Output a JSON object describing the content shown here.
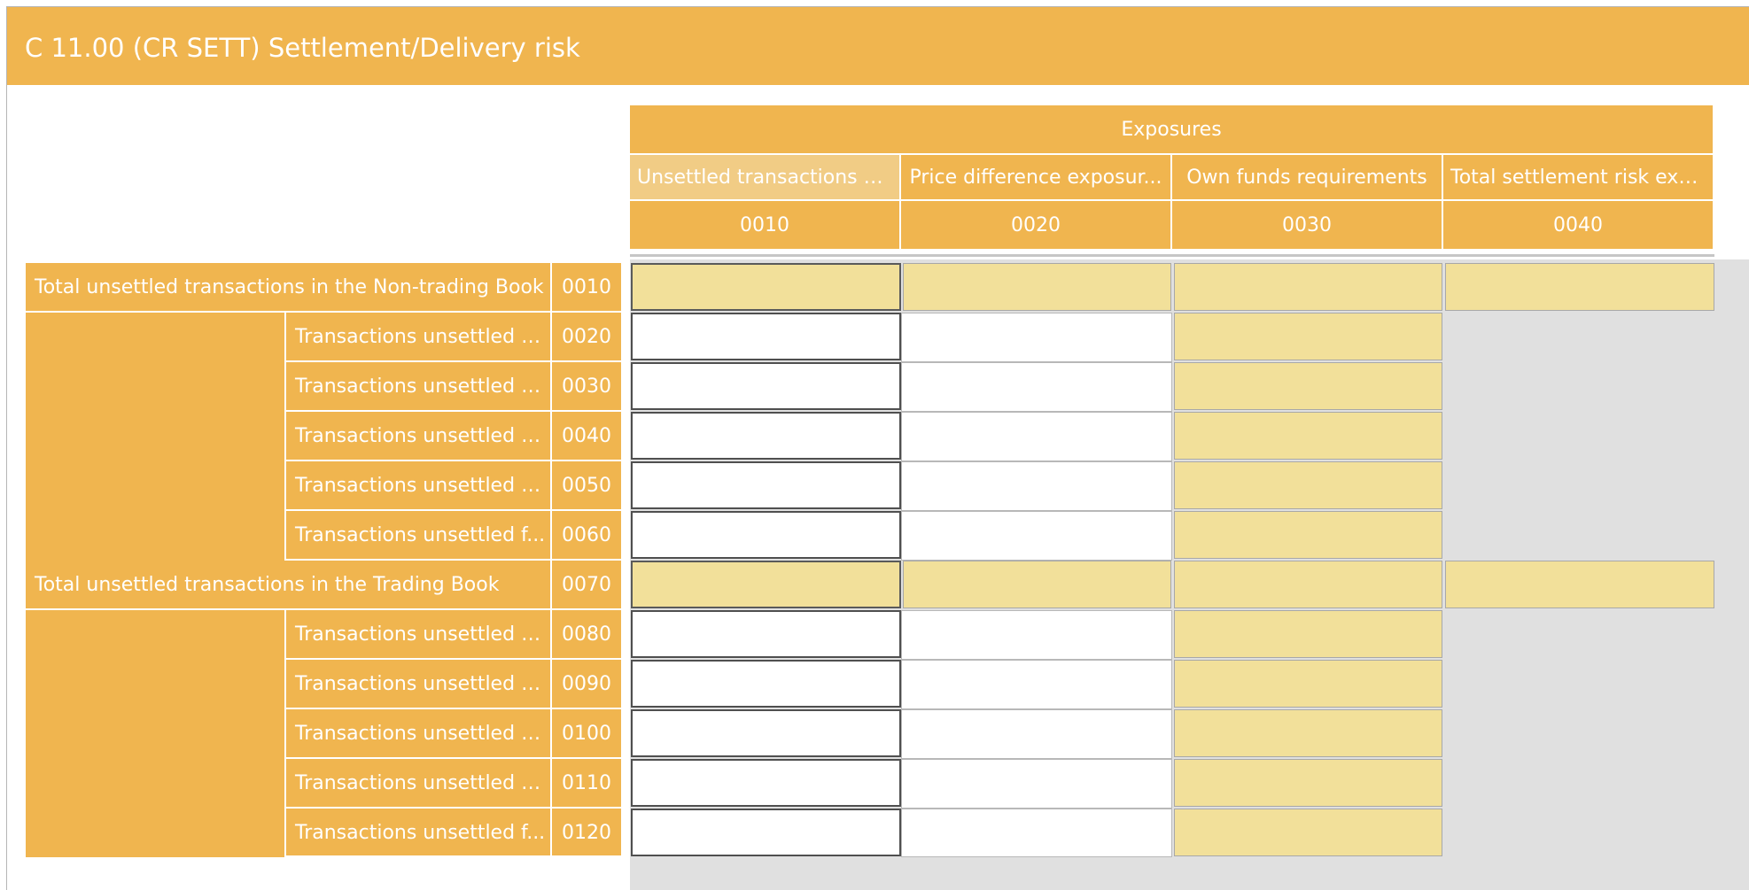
{
  "title": "C 11.00 (CR SETT) Settlement/Delivery risk",
  "header": {
    "group_label": "Exposures",
    "columns": [
      {
        "label": "Unsettled transactions a...",
        "code": "0010"
      },
      {
        "label": "Price difference exposur...",
        "code": "0020"
      },
      {
        "label": "Own funds requirements",
        "code": "0030"
      },
      {
        "label": "Total settlement risk exp...",
        "code": "0040"
      }
    ]
  },
  "rows": [
    {
      "label": "Total unsettled transactions in the Non-trading Book",
      "code": "0010"
    },
    {
      "label": "Transactions unsettled u...",
      "code": "0020"
    },
    {
      "label": "Transactions unsettled b...",
      "code": "0030"
    },
    {
      "label": "Transactions unsettled b...",
      "code": "0040"
    },
    {
      "label": "Transactions unsettled b...",
      "code": "0050"
    },
    {
      "label": "Transactions unsettled f...",
      "code": "0060"
    },
    {
      "label": "Total unsettled transactions in the Trading Book",
      "code": "0070"
    },
    {
      "label": "Transactions unsettled u...",
      "code": "0080"
    },
    {
      "label": "Transactions unsettled b...",
      "code": "0090"
    },
    {
      "label": "Transactions unsettled b...",
      "code": "0100"
    },
    {
      "label": "Transactions unsettled b...",
      "code": "0110"
    },
    {
      "label": "Transactions unsettled f...",
      "code": "0120"
    }
  ],
  "colors": {
    "header_orange": "#F0B54F",
    "header_highlight": "#F1CC85",
    "calculated_cell": "#F2E09A",
    "disabled_area": "#E0E0E0"
  }
}
